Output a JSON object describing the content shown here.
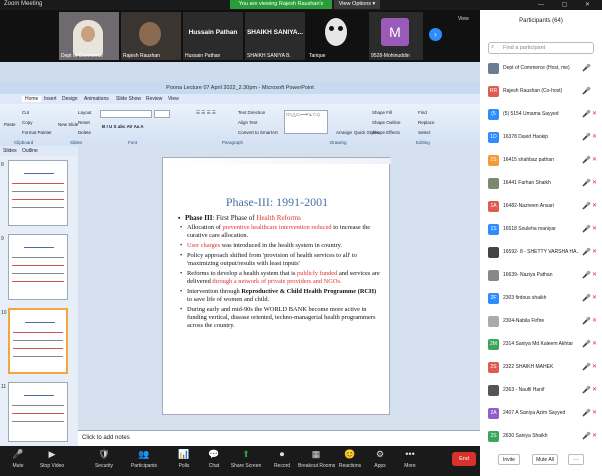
{
  "app": {
    "title": "Zoom Meeting",
    "viewing_banner": "You are viewing Rajesh Raushan's screen",
    "view_options": "View Options ▾",
    "view_button": "View"
  },
  "video_tiles": [
    {
      "name": "Dept of Commerce",
      "kind": "video"
    },
    {
      "name": "Rajesh Raushan",
      "kind": "video"
    },
    {
      "name": "Hussain Pathan",
      "big": "Hussain Pathan",
      "kind": "name"
    },
    {
      "name": "SHAIKH SANIYA B.",
      "big": "SHAIKH SANIYA...",
      "kind": "name"
    },
    {
      "name": "Tarique",
      "kind": "video"
    },
    {
      "name": "9528-Mohinuddin",
      "big": "M",
      "kind": "avatar"
    }
  ],
  "ppt": {
    "window_title": "Poona Lecture 07 April 2022_2.30pm - Microsoft PowerPoint",
    "tabs": [
      "Home",
      "Insert",
      "Design",
      "Animations",
      "Slide Show",
      "Review",
      "View"
    ],
    "groups": [
      "Clipboard",
      "Slides",
      "Font",
      "Paragraph",
      "Drawing",
      "Editing"
    ],
    "buttons": {
      "paste": "Paste",
      "cut": "Cut",
      "copy": "Copy",
      "format_painter": "Format Painter",
      "new_slide": "New Slide",
      "layout": "Layout",
      "reset": "Reset",
      "delete": "Delete",
      "text_direction": "Text Direction",
      "align_text": "Align Text",
      "convert_smartart": "Convert to SmartArt",
      "shapes": "Shapes",
      "arrange": "Arrange",
      "quick_styles": "Quick Styles",
      "shape_fill": "Shape Fill",
      "shape_outline": "Shape Outline",
      "shape_effects": "Shape Effects",
      "find": "Find",
      "replace": "Replace",
      "select": "Select"
    },
    "pane_tabs": [
      "Slides",
      "Outline"
    ],
    "thumbs": [
      "8",
      "9",
      "10",
      "11"
    ],
    "notes_placeholder": "Click to add notes"
  },
  "slide": {
    "title": "Phase-III: 1991-2001",
    "heading_pre": "Phase III",
    "heading_mid": ": First Phase of ",
    "heading_red": "Health Reforms",
    "bullets": [
      {
        "pre": "Allocation of ",
        "red": "preventive healthcare intervention reduced",
        "post": " to increase the curative care allocation."
      },
      {
        "pre": "",
        "red": "User charges",
        "post": " was introduced in the health system in country."
      },
      {
        "pre": "Policy approach shifted from 'provision of health services to all' to 'maximizing output/results with least inputs'",
        "red": "",
        "post": ""
      },
      {
        "pre": "Reforms to develop a health system that is ",
        "red": "publicly funded",
        "post": " and services are delivered ",
        "red2": "through a network of private providers and NGOs."
      },
      {
        "pre": "Intervention through ",
        "bold": "Reproductive & Child Health Programme (RCH)",
        "post": " to save life of women and child."
      },
      {
        "pre": "During early and mid-90s the WORLD BANK become more active in funding vertical, disease oriented, techno-managerial health programmers across the country.",
        "red": "",
        "post": ""
      }
    ]
  },
  "participants": {
    "title": "Participants (64)",
    "search_placeholder": "Find a participant",
    "list": [
      {
        "initials": "",
        "name": "Dept of Commerce (Host, me)",
        "color": "#6b7c93",
        "mic": "🎤",
        "cam": ""
      },
      {
        "initials": "RR",
        "name": "Rajesh Raushan (Co-host)",
        "color": "#e05a4f",
        "mic": "🎤",
        "cam": ""
      },
      {
        "initials": "(5",
        "name": "(5) 5154 Umama Sayyed",
        "color": "#2d8cff",
        "mic": "🎤",
        "cam": "✕"
      },
      {
        "initials": "1D",
        "name": "16378 David Haokip",
        "color": "#2d8cff",
        "mic": "🎤",
        "cam": "✕"
      },
      {
        "initials": "1S",
        "name": "16415 shahbaz pathan",
        "color": "#f29b38",
        "mic": "🎤",
        "cam": "✕"
      },
      {
        "initials": "",
        "name": "16441 Farhan Shaikh",
        "color": "#7a8a6f",
        "mic": "🎤",
        "cam": "✕"
      },
      {
        "initials": "1A",
        "name": "16482-Nazneen Ansari",
        "color": "#e05a4f",
        "mic": "🎤",
        "cam": "✕"
      },
      {
        "initials": "1S",
        "name": "16518 Souleha maniyar",
        "color": "#2d8cff",
        "mic": "🎤",
        "cam": "✕"
      },
      {
        "initials": "",
        "name": "16592- 8 - SHETTY VARSHA HA...",
        "color": "#444",
        "mic": "🎤",
        "cam": "✕"
      },
      {
        "initials": "",
        "name": "16639- Naziya Pathan",
        "color": "#888",
        "mic": "🎤",
        "cam": "✕"
      },
      {
        "initials": "2F",
        "name": "2303 firdous shaikh",
        "color": "#2d8cff",
        "mic": "🎤",
        "cam": "✕"
      },
      {
        "initials": "",
        "name": "2304-Nabila Firfire",
        "color": "#aaa",
        "mic": "🎤",
        "cam": "✕"
      },
      {
        "initials": "2M",
        "name": "2314 Saniya Md Kaleem Akhtar",
        "color": "#3aa55b",
        "mic": "🎤",
        "cam": "✕"
      },
      {
        "initials": "2S",
        "name": "2322 SHAIKH MAHEK",
        "color": "#e05a4f",
        "mic": "🎤",
        "cam": "✕"
      },
      {
        "initials": "",
        "name": "2363 - Naufil Hanif",
        "color": "#555",
        "mic": "🎤",
        "cam": "✕"
      },
      {
        "initials": "2A",
        "name": "2407 A Saniya Azim Sayyed",
        "color": "#8e5fc9",
        "mic": "🎤",
        "cam": "✕"
      },
      {
        "initials": "2S",
        "name": "2630 Saniya Shaikh",
        "color": "#3aa55b",
        "mic": "🎤",
        "cam": "✕"
      }
    ],
    "invite": "Invite",
    "mute_all": "Mute All",
    "more": "···"
  },
  "toolbar": [
    {
      "icon": "🎤",
      "label": "Mute"
    },
    {
      "icon": "▶",
      "label": "Stop Video"
    },
    {
      "icon": "🛡",
      "label": "Security"
    },
    {
      "icon": "👥",
      "label": "Participants",
      "badge": "64"
    },
    {
      "icon": "📊",
      "label": "Polls"
    },
    {
      "icon": "💬",
      "label": "Chat"
    },
    {
      "icon": "⬆",
      "label": "Share Screen"
    },
    {
      "icon": "⏺",
      "label": "Record"
    },
    {
      "icon": "▦",
      "label": "Breakout Rooms"
    },
    {
      "icon": "😊",
      "label": "Reactions"
    },
    {
      "icon": "⚙",
      "label": "Apps"
    },
    {
      "icon": "•••",
      "label": "More"
    }
  ],
  "end_label": "End",
  "colors": {
    "accent": "#2d8cff",
    "green": "#2a9d3a",
    "end": "#d9312b"
  }
}
